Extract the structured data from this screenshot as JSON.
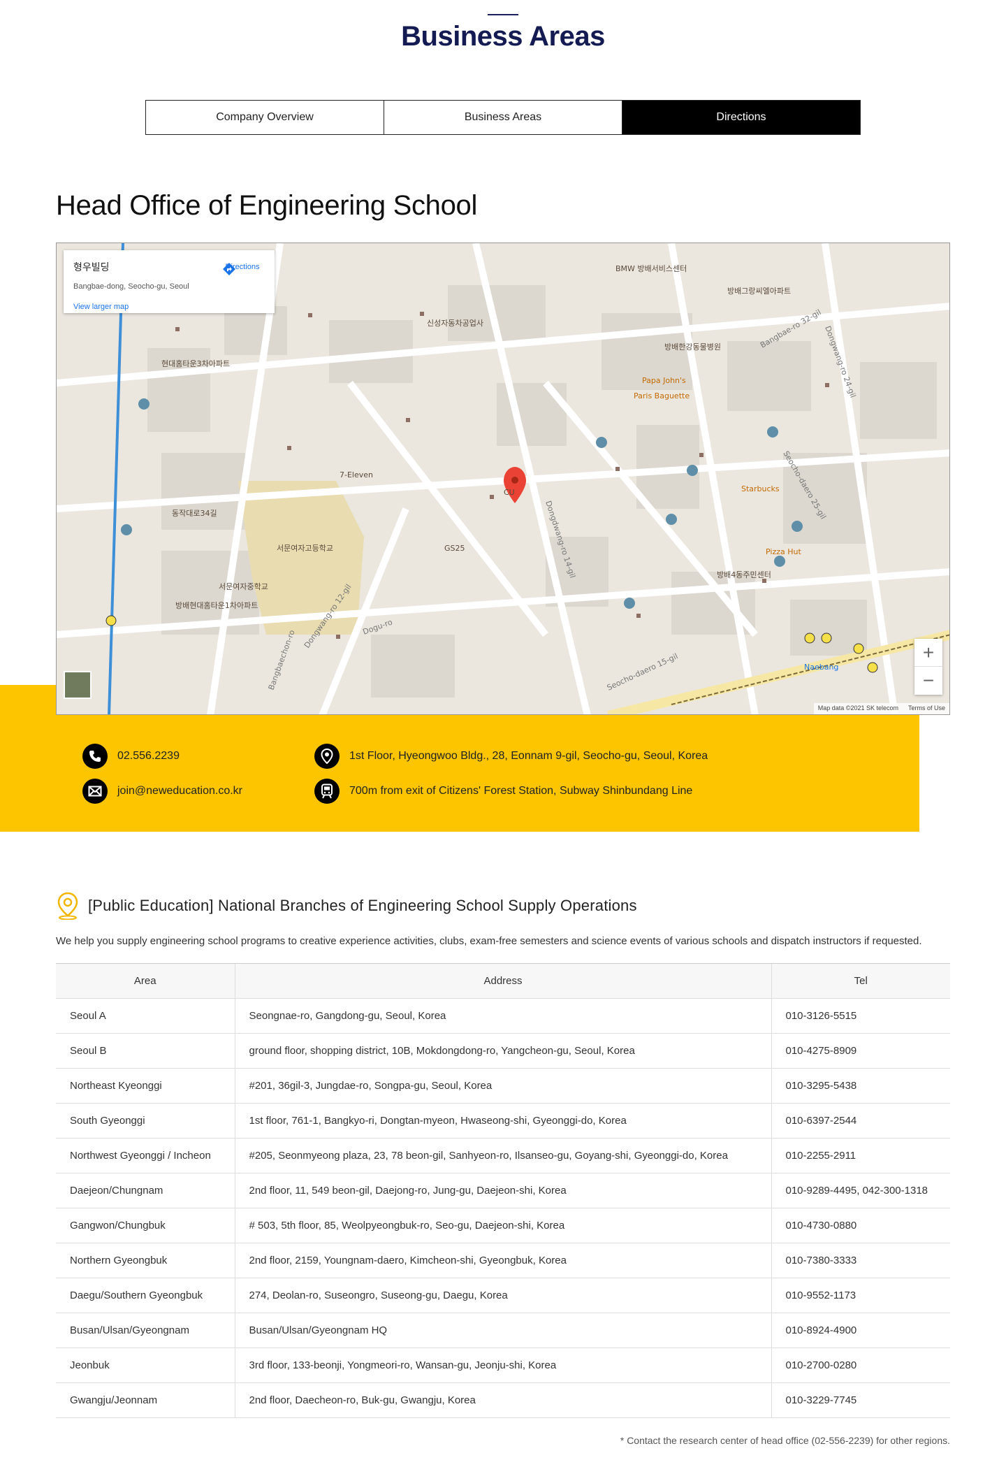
{
  "page": {
    "title": "Business Areas"
  },
  "tabs": [
    {
      "label": "Company Overview",
      "active": false
    },
    {
      "label": "Business Areas",
      "active": false
    },
    {
      "label": "Directions",
      "active": true
    }
  ],
  "office": {
    "title": "Head Office of Engineering School"
  },
  "map": {
    "place_name": "형우빌딩",
    "place_address": "Bangbae-dong, Seocho-gu, Seoul",
    "directions_label": "Directions",
    "larger_map_label": "View larger map",
    "attribution": "Map data ©2021 SK telecom",
    "terms_label": "Terms of Use",
    "zoom_in": "+",
    "zoom_out": "−",
    "labels": {
      "a": "방배그랑씨엘아파트",
      "b": "신성자동차공업사",
      "c": "방배한강동물병원",
      "d": "서문여자고등학교",
      "e": "방배4동주민센터",
      "f": "Starbucks",
      "g": "Pizza Hut",
      "h": "Naebang",
      "i": "GS25",
      "j": "7-Eleven",
      "k": "CU",
      "l": "Paris Baguette",
      "m": "Papa John's",
      "n": "Dongdwang-ro 14-gil",
      "o": "Seocho-daero 15-gil",
      "p": "Bangbaechon-ro",
      "q": "Dongwang-ro 12-gil",
      "r": "Dogu-ro",
      "s": "Bangbae-ro 32-gil",
      "t": "Dongwang-ro 24-gil",
      "u": "BMW 방배서비스센터",
      "v": "동작대로34길",
      "w": "서문여자중학교",
      "x": "방배현대홈타운1차아파트",
      "y": "현대홈타운3차아파트",
      "z": "Seocho-daero 25-gil"
    },
    "colors": {
      "land": "#ebe7df",
      "road": "#ffffff",
      "block": "#dcd8d0",
      "park": "#e8dcb0",
      "subway": "#3d8fd8",
      "pin": "#ea4335",
      "poi": "#8d6e63"
    }
  },
  "contacts": {
    "phone": {
      "icon": "phone-icon",
      "text": "02.556.2239"
    },
    "email": {
      "icon": "mail-icon",
      "text": "join@neweducation.co.kr"
    },
    "address": {
      "icon": "map-pin-icon",
      "text": "1st Floor, Hyeongwoo Bldg., 28, Eonnam 9-gil, Seocho-gu, Seoul, Korea"
    },
    "subway": {
      "icon": "subway-icon",
      "text": "700m from exit of Citizens' Forest Station, Subway Shinbundang Line"
    }
  },
  "band_color": "#fdc400",
  "branches": {
    "title": "[Public Education] National Branches of Engineering School Supply Operations",
    "description": "We help you supply engineering school programs to creative experience activities, clubs, exam-free semesters and science events of various schools and dispatch instructors if requested.",
    "columns": [
      "Area",
      "Address",
      "Tel"
    ],
    "rows": [
      [
        "Seoul A",
        "Seongnae-ro, Gangdong-gu, Seoul, Korea",
        "010-3126-5515"
      ],
      [
        "Seoul B",
        "ground floor, shopping district, 10B, Mokdongdong-ro, Yangcheon-gu, Seoul, Korea",
        "010-4275-8909"
      ],
      [
        "Northeast Kyeonggi",
        "#201, 36gil-3, Jungdae-ro, Songpa-gu, Seoul, Korea",
        "010-3295-5438"
      ],
      [
        "South Gyeonggi",
        "1st floor, 761-1, Bangkyo-ri, Dongtan-myeon, Hwaseong-shi, Gyeonggi-do, Korea",
        "010-6397-2544"
      ],
      [
        "Northwest Gyeonggi / Incheon",
        "#205, Seonmyeong plaza, 23, 78 beon-gil, Sanhyeon-ro, Ilsanseo-gu, Goyang-shi, Gyeonggi-do, Korea",
        "010-2255-2911"
      ],
      [
        "Daejeon/Chungnam",
        "2nd floor, 11, 549 beon-gil, Daejong-ro, Jung-gu, Daejeon-shi, Korea",
        "010-9289-4495, 042-300-1318"
      ],
      [
        "Gangwon/Chungbuk",
        "# 503, 5th floor, 85, Weolpyeongbuk-ro, Seo-gu, Daejeon-shi, Korea",
        "010-4730-0880"
      ],
      [
        "Northern Gyeongbuk",
        "2nd floor, 2159, Youngnam-daero, Kimcheon-shi, Gyeongbuk, Korea",
        "010-7380-3333"
      ],
      [
        "Daegu/Southern Gyeongbuk",
        "274, Deolan-ro, Suseongro, Suseong-gu, Daegu, Korea",
        "010-9552-1173"
      ],
      [
        "Busan/Ulsan/Gyeongnam",
        "Busan/Ulsan/Gyeongnam HQ",
        "010-8924-4900"
      ],
      [
        "Jeonbuk",
        "3rd floor, 133-beonji, Yongmeori-ro, Wansan-gu, Jeonju-shi, Korea",
        "010-2700-0280"
      ],
      [
        "Gwangju/Jeonnam",
        "2nd floor, Daecheon-ro, Buk-gu, Gwangju, Korea",
        "010-3229-7745"
      ]
    ],
    "note": "* Contact the research center of head office (02-556-2239) for other regions."
  }
}
